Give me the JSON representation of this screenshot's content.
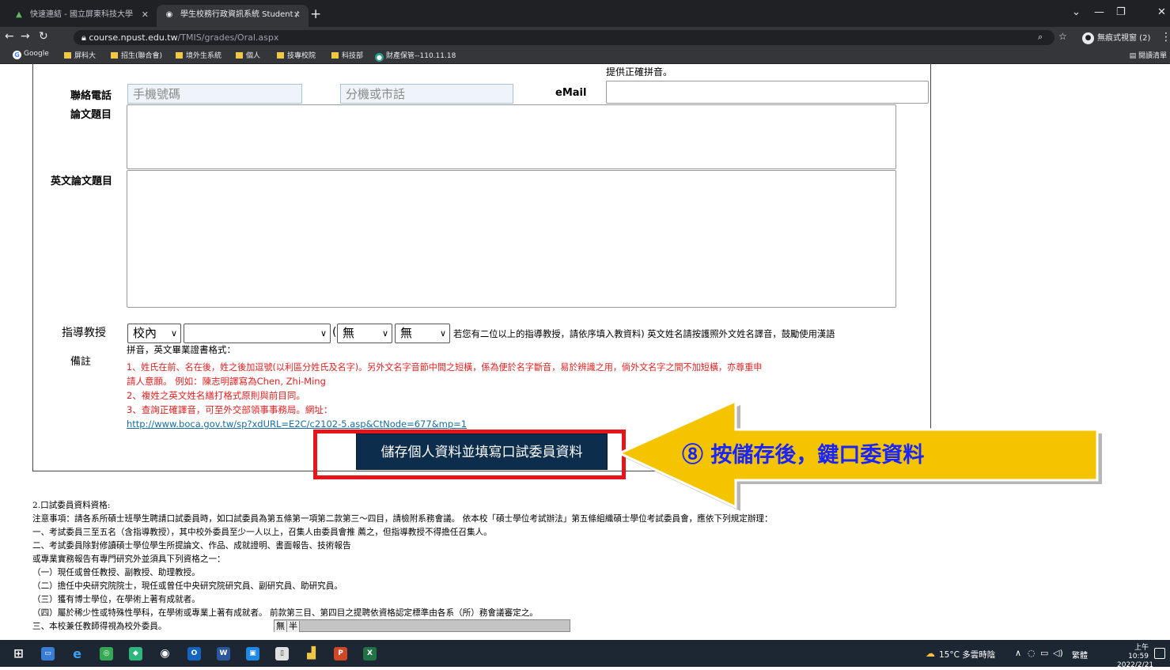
{
  "browser": {
    "tabs": [
      {
        "title": "快速連結 - 國立屏東科技大學"
      },
      {
        "title": "學生校務行政資訊系統 Student /"
      }
    ],
    "new_tab": "+",
    "url_host": "course.npust.edu.tw",
    "url_path": "/TMIS/grades/Oral.aspx",
    "profile": "無痕式視窗 (2)",
    "bookmarks": [
      "Google",
      "屏科大",
      "招生(聯合會)",
      "境外生系統",
      "個人",
      "技專校院",
      "科技部",
      "財產保管--110.11.18"
    ],
    "reading_list": "閱讀清單"
  },
  "form": {
    "email_hint": "提供正確拼音。",
    "phone_label": "聯絡電話",
    "mobile_placeholder": "手機號碼",
    "ext_placeholder": "分機或市話",
    "email_label": "eMail",
    "email_value": "",
    "thesis_label": "論文題目",
    "thesis_value": "",
    "en_thesis_label": "英文論文題目",
    "en_thesis_value": "",
    "advisor_label": "指導教授",
    "advisor_scope": "校內",
    "advisor_name": "",
    "advisor_paren": "(",
    "advisor_opt1": "無",
    "advisor_opt2": "無",
    "advisor_note": "若您有二位以上的指導教授，請依序填入教資料) 英文姓名請按護照外文姓名譯音，鼓勵使用漢語",
    "remarks_label": "備註",
    "remarks": [
      "拼音，英文畢業證書格式：",
      "1、姓氏在前、名在後，姓之後加逗號(以利區分姓氏及名字)。另外文名字音節中間之短橫，係為便於名字斷音，易於辨識之用，倘外文名字之間不加短橫，亦尊重申",
      "請人意願。 例如：陳志明譯寫為Chen, Zhi-Ming",
      "2、複姓之英文姓名繕打格式原則與前目同。",
      "3、查詢正確譯音，可至外交部領事事務局。網址："
    ],
    "link": "http://www.boca.gov.tw/sp?xdURL=E2C/c2102-5.asp&CtNode=677&mp=1",
    "save_button": "儲存個人資料並填寫口試委員資料"
  },
  "callout": {
    "text": "⑧ 按儲存後，鍵口委資料"
  },
  "notes": [
    "2.口試委員資料資格:",
    "注意事項：請各系所碩士班學生聘請口試委員時，如口試委員為第五條第一項第二款第三～四目，請檢附系務會議。 依本校「碩士學位考試辦法」第五條組織碩士學位考試委員會，應依下列規定辦理：",
    "一、考試委員三至五名（含指導教授），其中校外委員至少一人以上，召集人由委員會推 薦之，但指導教授不得擔任召集人。",
    "二、考試委員除對修讀碩士學位學生所提論文、作品、成就證明、書面報告、技術報告",
    "或專業實務報告有專門研究外並須具下列資格之一：",
    "（一）現任或曾任教授、副教授、助理教授。",
    "（二）擔任中央研究院院士，現任或曾任中央研究院研究員、副研究員、助研究員。",
    "（三）獲有博士學位，在學術上著有成就者。",
    "（四）屬於稀少性或特殊性學科，在學術或專業上著有成就者。 前款第三目、第四目之提聘依資格認定標準由各系（所）務會議審定之。",
    "三、本校兼任教師得視為校外委員。"
  ],
  "ime": {
    "mode1": "無",
    "mode2": "半"
  },
  "taskbar": {
    "weather": "15°C 多雲時陰",
    "ime_indicator": "繁體",
    "time": "上午 10:59",
    "date": "2022/2/21"
  },
  "colors": {
    "callout_fill": "#f5c400",
    "highlight_border": "#e8141b",
    "button_bg": "#0d2d4d",
    "remark_red": "#e02020"
  }
}
